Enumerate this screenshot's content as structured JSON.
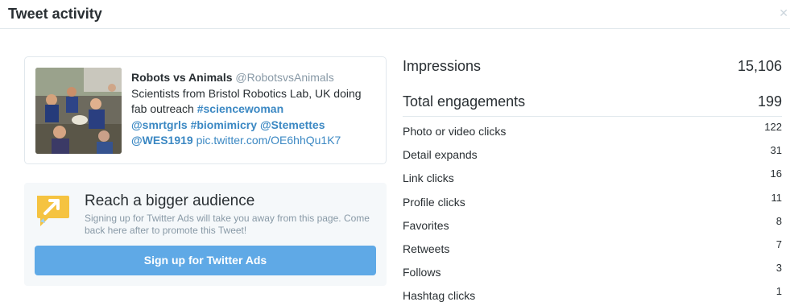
{
  "header": {
    "title": "Tweet activity",
    "close_icon": "close-icon"
  },
  "tweet": {
    "name": "Robots vs Animals",
    "handle": "@RobotsvsAnimals",
    "text_plain": "Scientists from Bristol Robotics Lab, UK doing fab outreach",
    "hashtag1": "#sciencewoman",
    "mention1": "@smrtgrls",
    "hashtag2": "#biomimicry",
    "mention2": "@Stemettes",
    "mention3": "@WES1919",
    "link": "pic.twitter.com/OE6hhQu1K7",
    "thumbnail_icon": "tweet-photo"
  },
  "promo": {
    "icon": "reach-icon",
    "title": "Reach a bigger audience",
    "subtitle": "Signing up for Twitter Ads will take you away from this page. Come back here after to promote this Tweet!",
    "button_label": "Sign up for Twitter Ads"
  },
  "metrics": {
    "impressions": {
      "label": "Impressions",
      "value": "15,106"
    },
    "engagements": {
      "label": "Total engagements",
      "value": "199"
    },
    "breakdown": [
      {
        "label": "Photo or video clicks",
        "value": "122"
      },
      {
        "label": "Detail expands",
        "value": "31"
      },
      {
        "label": "Link clicks",
        "value": "16"
      },
      {
        "label": "Profile clicks",
        "value": "11"
      },
      {
        "label": "Favorites",
        "value": "8"
      },
      {
        "label": "Retweets",
        "value": "7"
      },
      {
        "label": "Follows",
        "value": "3"
      },
      {
        "label": "Hashtag clicks",
        "value": "1"
      }
    ]
  },
  "colors": {
    "link": "#3b88c3",
    "button": "#5fa9e6",
    "promo_bg": "#f5f8fa",
    "icon_yellow": "#f5c341"
  }
}
